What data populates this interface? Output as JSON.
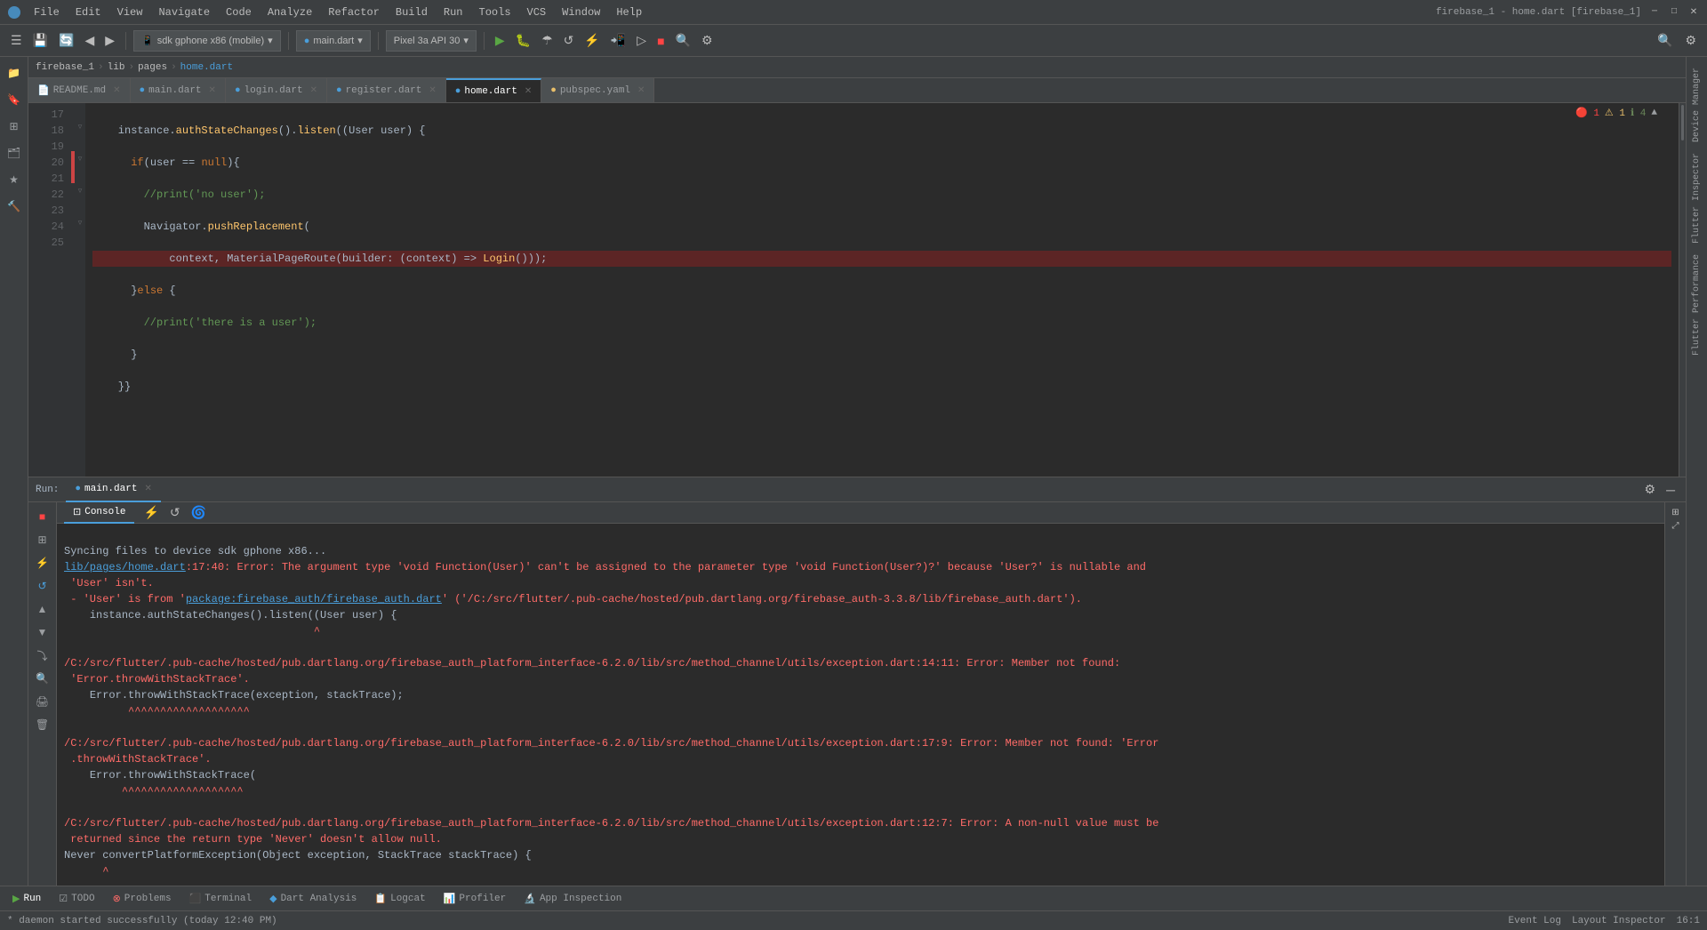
{
  "window": {
    "title": "firebase_1 - home.dart [firebase_1]"
  },
  "menubar": {
    "items": [
      "File",
      "Edit",
      "View",
      "Navigate",
      "Code",
      "Analyze",
      "Refactor",
      "Build",
      "Run",
      "Tools",
      "VCS",
      "Window",
      "Help"
    ]
  },
  "toolbar": {
    "sdk_label": "sdk gphone x86 (mobile)",
    "file_label": "main.dart",
    "device_label": "Pixel 3a API 30",
    "icons": [
      "back",
      "forward",
      "refresh",
      "run",
      "pause",
      "stop",
      "debug",
      "profile",
      "attach"
    ]
  },
  "breadcrumb": {
    "parts": [
      "firebase_1",
      "lib",
      "pages",
      "home.dart"
    ]
  },
  "tabs": [
    {
      "label": "README.md",
      "type": "md",
      "active": false
    },
    {
      "label": "main.dart",
      "type": "dart",
      "active": false
    },
    {
      "label": "login.dart",
      "type": "dart",
      "active": false
    },
    {
      "label": "register.dart",
      "type": "dart",
      "active": false
    },
    {
      "label": "home.dart",
      "type": "dart",
      "active": true
    },
    {
      "label": "pubspec.yaml",
      "type": "yaml",
      "active": false
    }
  ],
  "code": {
    "lines": [
      {
        "num": "17",
        "content": "    instance.authStateChanges().listen((User user) {",
        "highlight": false
      },
      {
        "num": "18",
        "content": "      if(user == null){",
        "highlight": false
      },
      {
        "num": "19",
        "content": "        //print('no user');",
        "highlight": false
      },
      {
        "num": "20",
        "content": "        Navigator.pushReplacement(",
        "highlight": false
      },
      {
        "num": "21",
        "content": "            context, MaterialPageRoute(builder: (context) => Login()));",
        "highlight": true
      },
      {
        "num": "22",
        "content": "      }else {",
        "highlight": false
      },
      {
        "num": "23",
        "content": "        //print('there is a user');",
        "highlight": false
      },
      {
        "num": "24",
        "content": "      }",
        "highlight": false
      },
      {
        "num": "25",
        "content": "    }}",
        "highlight": false
      }
    ],
    "error_count": "1",
    "warning_count": "1",
    "info_count": "4"
  },
  "run_panel": {
    "tab_label": "Run:",
    "file_label": "main.dart",
    "console_label": "Console",
    "output": [
      {
        "type": "normal",
        "text": "Syncing files to device sdk gphone x86..."
      },
      {
        "type": "error",
        "text": "lib/pages/home.dart:17:40: Error: The argument type 'void Function(User)' can't be assigned to the parameter type 'void Function(User?)?' because 'User?' is nullable and"
      },
      {
        "type": "error",
        "text": " 'User' isn't."
      },
      {
        "type": "error_mixed",
        "prefix": " - 'User' is from '",
        "link": "package:firebase_auth/firebase_auth.dart",
        "suffix": "' ('/C:/src/flutter/.pub-cache/hosted/pub.dartlang.org/firebase_auth-3.3.8/lib/firebase_auth.dart')."
      },
      {
        "type": "code",
        "text": "    instance.authStateChanges().listen((User user) {"
      },
      {
        "type": "pointer",
        "text": "                                       ^"
      },
      {
        "type": "blank"
      },
      {
        "type": "error",
        "text": "/C:/src/flutter/.pub-cache/hosted/pub.dartlang.org/firebase_auth_platform_interface-6.2.0/lib/src/method_channel/utils/exception.dart:14:11: Error: Member not found:"
      },
      {
        "type": "error",
        "text": " 'Error.throwWithStackTrace'."
      },
      {
        "type": "code",
        "text": "    Error.throwWithStackTrace(exception, stackTrace);"
      },
      {
        "type": "pointer",
        "text": "          ^^^^^^^^^^^^^^^^^^^"
      },
      {
        "type": "blank"
      },
      {
        "type": "error",
        "text": "/C:/src/flutter/.pub-cache/hosted/pub.dartlang.org/firebase_auth_platform_interface-6.2.0/lib/src/method_channel/utils/exception.dart:17:9: Error: Member not found: 'Error"
      },
      {
        "type": "error",
        "text": " .throwWithStackTrace'."
      },
      {
        "type": "code",
        "text": "    Error.throwWithStackTrace("
      },
      {
        "type": "pointer",
        "text": "         ^^^^^^^^^^^^^^^^^^^"
      },
      {
        "type": "blank"
      },
      {
        "type": "error",
        "text": "/C:/src/flutter/.pub-cache/hosted/pub.dartlang.org/firebase_auth_platform_interface-6.2.0/lib/src/method_channel/utils/exception.dart:12:7: Error: A non-null value must be"
      },
      {
        "type": "error",
        "text": " returned since the return type 'Never' doesn't allow null."
      },
      {
        "type": "code",
        "text": "Never convertPlatformException(Object exception, StackTrace stackTrace) {"
      },
      {
        "type": "pointer",
        "text": "      ^"
      }
    ]
  },
  "bottom_tools": [
    {
      "label": "Run",
      "icon": "▶"
    },
    {
      "label": "TODO"
    },
    {
      "label": "Problems"
    },
    {
      "label": "Terminal"
    },
    {
      "label": "Dart Analysis"
    },
    {
      "label": "Logcat"
    },
    {
      "label": "Profiler"
    },
    {
      "label": "App Inspection"
    }
  ],
  "status_bar": {
    "daemon_text": "* daemon started successfully (today 12:40 PM)",
    "event_log": "Event Log",
    "layout_inspector": "Layout Inspector",
    "cursor_pos": "16:1"
  },
  "right_sidebar": {
    "labels": [
      "Device Manager",
      "Flutter Inspector",
      "Flutter Performance"
    ]
  },
  "run_right_sidebar": {
    "labels": [
      "Device Manager",
      "Flutter Inspector",
      "Flutter Performance"
    ]
  }
}
